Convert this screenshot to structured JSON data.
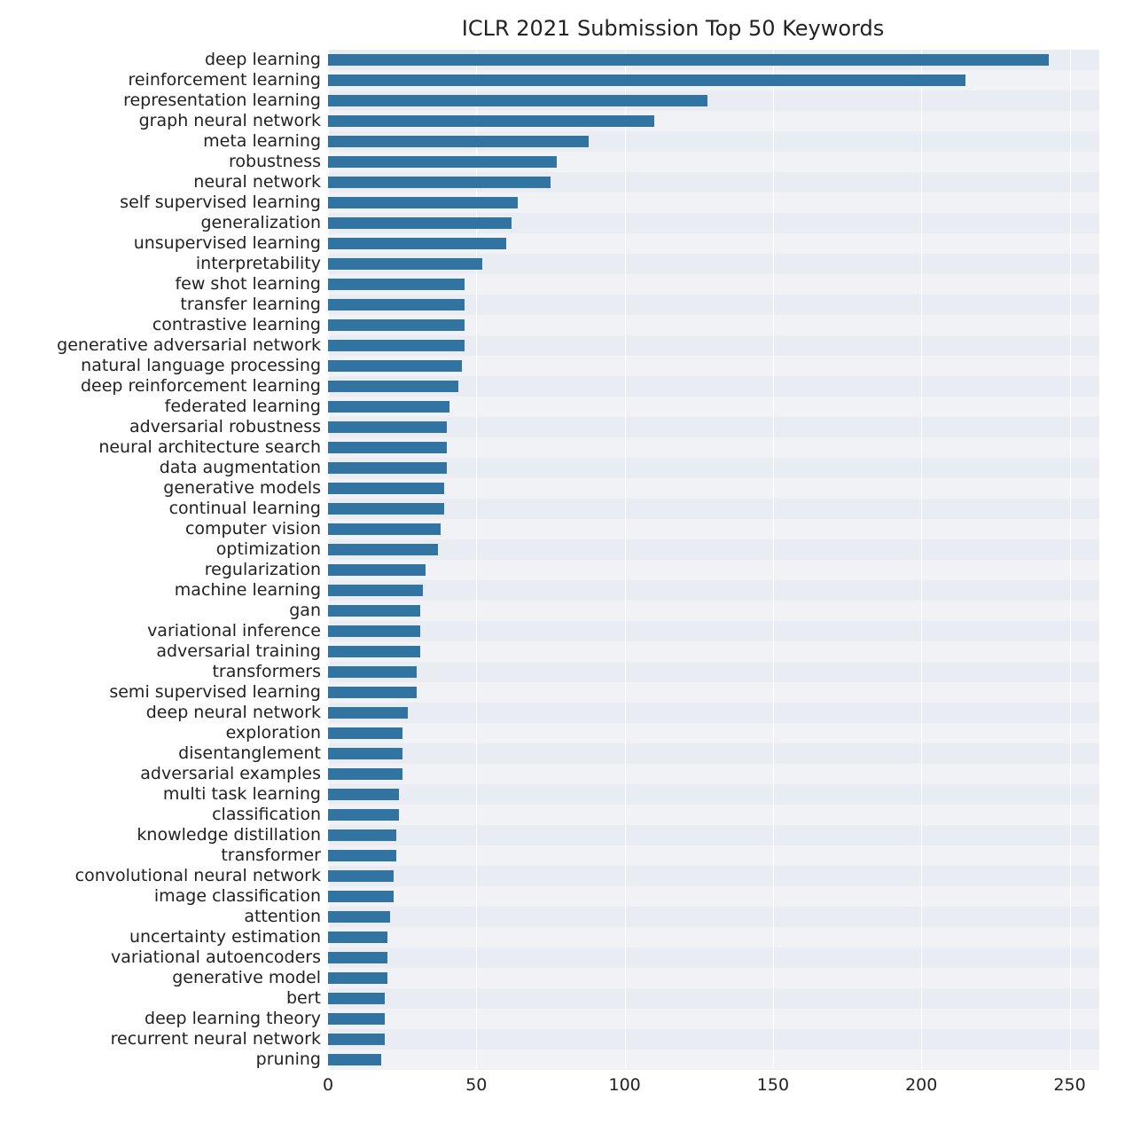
{
  "chart_data": {
    "type": "bar",
    "orientation": "horizontal",
    "title": "ICLR 2021 Submission Top 50 Keywords",
    "xlabel": "",
    "ylabel": "",
    "xlim": [
      0,
      260
    ],
    "xticks": [
      0,
      50,
      100,
      150,
      200,
      250
    ],
    "bar_color": "#3274a1",
    "plot_bg": "#e9ecf2",
    "categories": [
      "deep learning",
      "reinforcement learning",
      "representation learning",
      "graph neural network",
      "meta learning",
      "robustness",
      "neural network",
      "self supervised learning",
      "generalization",
      "unsupervised learning",
      "interpretability",
      "few shot learning",
      "transfer learning",
      "contrastive learning",
      "generative adversarial network",
      "natural language processing",
      "deep reinforcement learning",
      "federated learning",
      "adversarial robustness",
      "neural architecture search",
      "data augmentation",
      "generative models",
      "continual learning",
      "computer vision",
      "optimization",
      "regularization",
      "machine learning",
      "gan",
      "variational inference",
      "adversarial training",
      "transformers",
      "semi supervised learning",
      "deep neural network",
      "exploration",
      "disentanglement",
      "adversarial examples",
      "multi task learning",
      "classification",
      "knowledge distillation",
      "transformer",
      "convolutional neural network",
      "image classification",
      "attention",
      "uncertainty estimation",
      "variational autoencoders",
      "generative model",
      "bert",
      "deep learning theory",
      "recurrent neural network",
      "pruning"
    ],
    "values": [
      243,
      215,
      128,
      110,
      88,
      77,
      75,
      64,
      62,
      60,
      52,
      46,
      46,
      46,
      46,
      45,
      44,
      41,
      40,
      40,
      40,
      39,
      39,
      38,
      37,
      33,
      32,
      31,
      31,
      31,
      30,
      30,
      27,
      25,
      25,
      25,
      24,
      24,
      23,
      23,
      22,
      22,
      21,
      20,
      20,
      20,
      19,
      19,
      19,
      18
    ]
  }
}
